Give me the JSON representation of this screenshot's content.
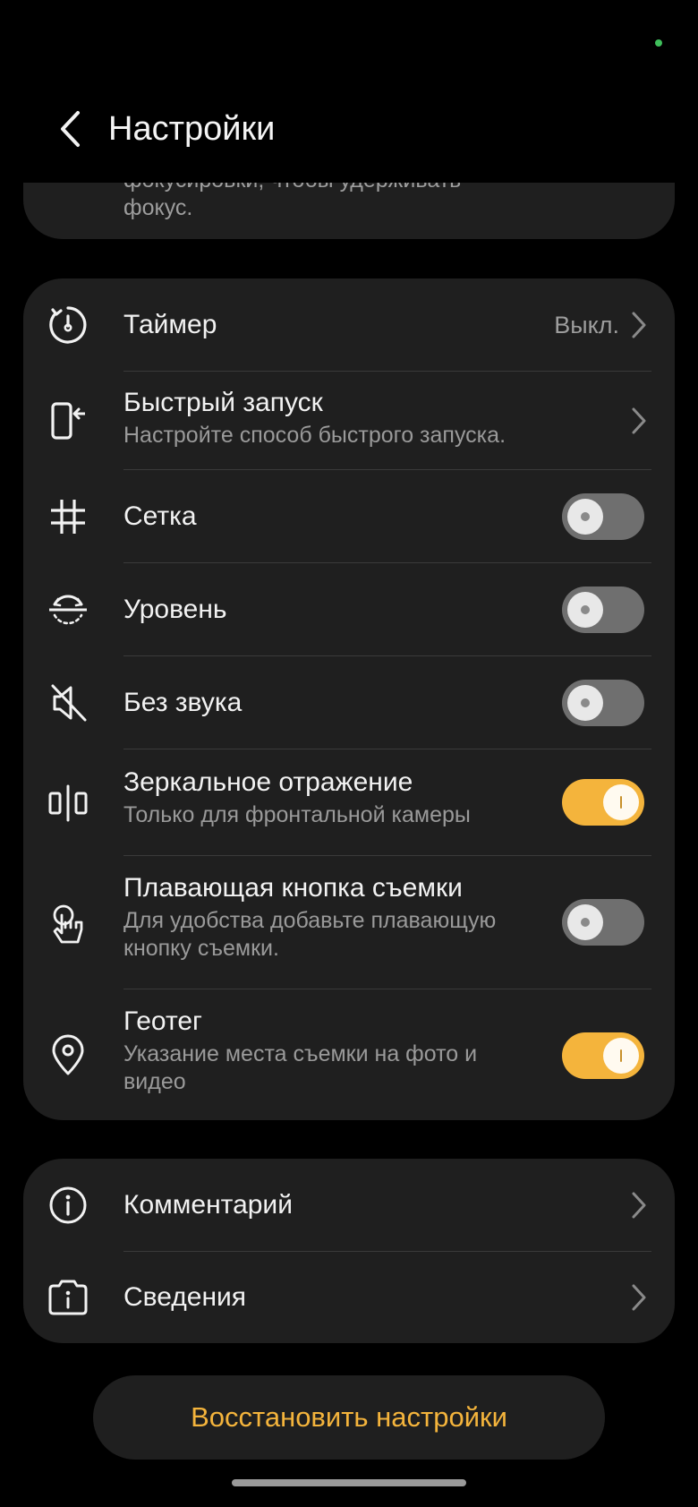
{
  "header": {
    "title": "Настройки"
  },
  "partial_card": {
    "text_line1": "фокусировки, чтобы удерживать",
    "text_line2": "фокус."
  },
  "settings": {
    "timer": {
      "title": "Таймер",
      "value": "Выкл.",
      "icon": "timer-icon"
    },
    "quick_launch": {
      "title": "Быстрый запуск",
      "subtitle": "Настройте способ быстрого запуска.",
      "icon": "quick-launch-icon"
    },
    "grid": {
      "title": "Сетка",
      "enabled": false,
      "icon": "grid-icon"
    },
    "level": {
      "title": "Уровень",
      "enabled": false,
      "icon": "level-icon"
    },
    "mute": {
      "title": "Без звука",
      "enabled": false,
      "icon": "mute-icon"
    },
    "mirror": {
      "title": "Зеркальное отражение",
      "subtitle": "Только для фронтальной камеры",
      "enabled": true,
      "icon": "mirror-icon"
    },
    "floating_shutter": {
      "title": "Плавающая кнопка съемки",
      "subtitle_line1": "Для удобства добавьте плавающую",
      "subtitle_line2": "кнопку съемки.",
      "enabled": false,
      "icon": "floating-shutter-icon"
    },
    "geotag": {
      "title": "Геотег",
      "subtitle_line1": "Указание места съемки на фото и",
      "subtitle_line2": "видео",
      "enabled": true,
      "icon": "location-pin-icon"
    }
  },
  "info": {
    "feedback": {
      "title": "Комментарий",
      "icon": "info-icon"
    },
    "about": {
      "title": "Сведения",
      "icon": "camera-info-icon"
    }
  },
  "reset_button": {
    "label": "Восстановить настройки"
  },
  "colors": {
    "accent": "#f4b43c",
    "card": "#1f1f1f",
    "background": "#000000",
    "status_dot": "#3fbf5b"
  }
}
